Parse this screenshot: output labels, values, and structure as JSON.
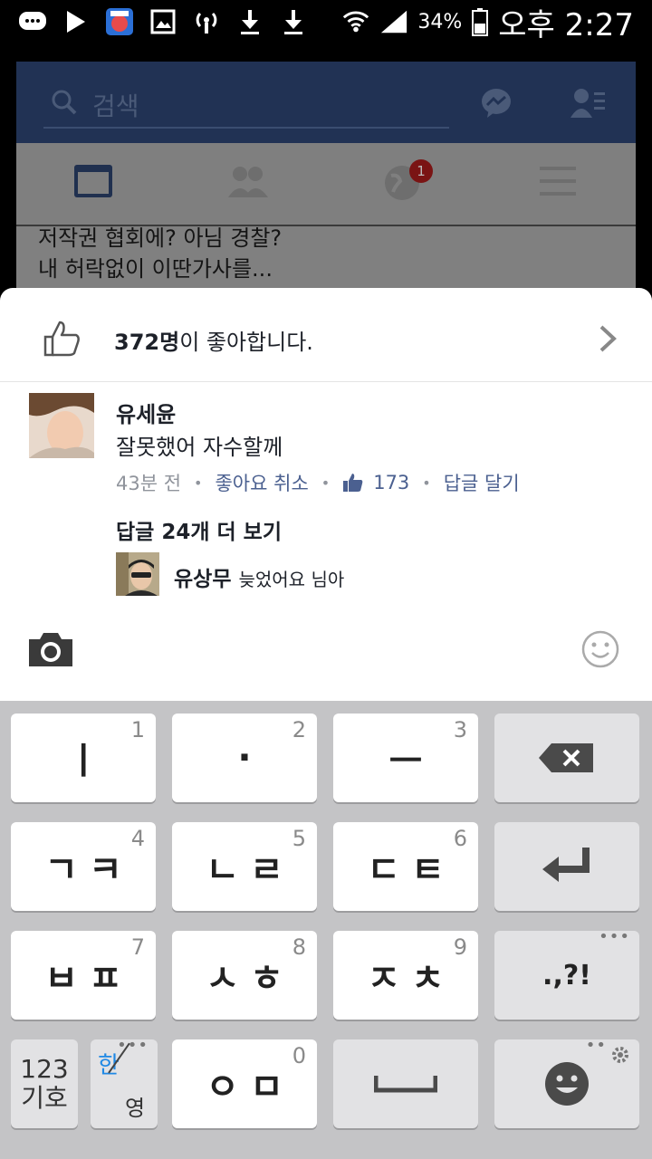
{
  "status_bar": {
    "battery": "34%",
    "time": "오후 2:27"
  },
  "background": {
    "search_placeholder": "검색",
    "notification_badge": "1",
    "post_lines": [
      "저작권 협회에? 아님 경찰?",
      "내 허락없이 이딴가사를..."
    ]
  },
  "likes_sheet": {
    "like_count": "372명",
    "like_suffix": "이 좋아합니다."
  },
  "comment": {
    "author": "유세윤",
    "text": "잘못했어 자수할께",
    "time": "43분 전",
    "unlike_label": "좋아요 취소",
    "like_count": "173",
    "reply_label": "답글 달기",
    "more_replies": "답글 24개 더 보기",
    "reply": {
      "author": "유상무",
      "text": "늦었어요 님아"
    }
  },
  "keyboard": {
    "rows": [
      [
        {
          "label": "ㅣ",
          "num": "1"
        },
        {
          "label": "·",
          "num": "2"
        },
        {
          "label": "ㅡ",
          "num": "3"
        }
      ],
      [
        {
          "label": "ㄱㅋ",
          "num": "4"
        },
        {
          "label": "ㄴㄹ",
          "num": "5"
        },
        {
          "label": "ㄷㅌ",
          "num": "6"
        }
      ],
      [
        {
          "label": "ㅂㅍ",
          "num": "7"
        },
        {
          "label": "ㅅㅎ",
          "num": "8"
        },
        {
          "label": "ㅈㅊ",
          "num": "9"
        }
      ]
    ],
    "punct_label": ".,?!",
    "num_mode_top": "123",
    "num_mode_bottom": "기호",
    "lang_han": "한",
    "lang_eng": "영",
    "bottom_key": {
      "label": "ㅇㅁ",
      "num": "0"
    }
  }
}
